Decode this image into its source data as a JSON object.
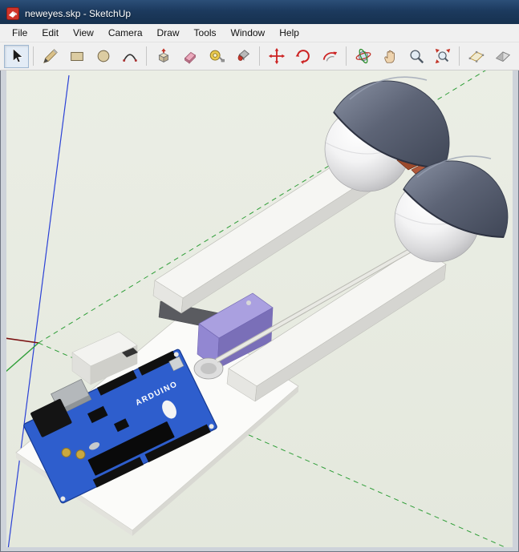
{
  "window": {
    "title": "neweyes.skp - SketchUp"
  },
  "menu_bar": {
    "items": [
      "File",
      "Edit",
      "View",
      "Camera",
      "Draw",
      "Tools",
      "Window",
      "Help"
    ]
  },
  "toolbar": {
    "tools": [
      {
        "name": "select",
        "label": "Select"
      },
      {
        "name": "line",
        "label": "Line"
      },
      {
        "name": "rectangle",
        "label": "Rectangle"
      },
      {
        "name": "circle",
        "label": "Circle"
      },
      {
        "name": "arc",
        "label": "Arc"
      },
      {
        "name": "push-pull",
        "label": "Push/Pull"
      },
      {
        "name": "eraser",
        "label": "Eraser"
      },
      {
        "name": "tape-measure",
        "label": "Tape Measure"
      },
      {
        "name": "paint-bucket",
        "label": "Paint Bucket"
      },
      {
        "name": "move",
        "label": "Move"
      },
      {
        "name": "rotate",
        "label": "Rotate"
      },
      {
        "name": "offset",
        "label": "Offset"
      },
      {
        "name": "orbit",
        "label": "Orbit"
      },
      {
        "name": "pan",
        "label": "Pan"
      },
      {
        "name": "zoom",
        "label": "Zoom"
      },
      {
        "name": "zoom-extents",
        "label": "Zoom Extents"
      },
      {
        "name": "section-plane",
        "label": "Section Plane"
      },
      {
        "name": "section-display",
        "label": "Display Section Cuts"
      }
    ]
  },
  "viewport": {
    "background": "#e8ebe2",
    "axes": {
      "red": "#7a1010",
      "green": "#2f9e38",
      "blue": "#2b41d6"
    }
  },
  "model": {
    "arduino": {
      "label": "ARDUINO",
      "board_color": "#2e5ecd"
    },
    "colors": {
      "base": "#fbfbf9",
      "beam_top": "#f6f6f3",
      "beam_side": "#d5d5d1",
      "sphere": "#e9e9ea",
      "eyelid_shell": "#5d6476",
      "servo_body": "#9287d2",
      "linkage": "#9c4a2c",
      "title_bar": "#1c3a5e"
    }
  }
}
